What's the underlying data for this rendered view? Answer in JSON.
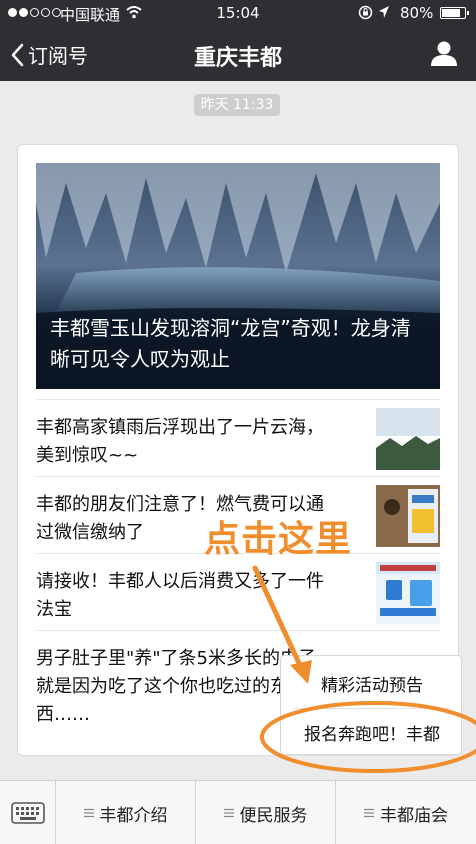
{
  "status_bar": {
    "carrier": "中国联通",
    "time": "15:04",
    "battery_percent": "80%",
    "battery_level": 0.8
  },
  "nav": {
    "back_label": "订阅号",
    "title": "重庆丰都"
  },
  "chat": {
    "timestamp": "昨天 11:33"
  },
  "article": {
    "hero_title": "丰都雪玉山发现溶洞“龙宫”奇观！龙身清晰可见令人叹为观止",
    "items": [
      {
        "title": "丰都高家镇雨后浮现出了一片云海，美到惊叹~~"
      },
      {
        "title": "丰都的朋友们注意了！燃气费可以通过微信缴纳了"
      },
      {
        "title": "请接收！丰都人以后消费又多了一件法宝"
      },
      {
        "title": "男子肚子里\"养\"了条5米多长的虫子，就是因为吃了这个你也吃过的东西……"
      }
    ]
  },
  "popup_menu": {
    "items": [
      "精彩活动预告",
      "报名奔跑吧！丰都"
    ]
  },
  "annotation": {
    "text": "点击这里",
    "color": "#f08d2c"
  },
  "bottom_menu": {
    "items": [
      "丰都介绍",
      "便民服务",
      "丰都庙会"
    ]
  },
  "colors": {
    "header_bg": "#2e2e33",
    "chat_bg": "#ebebeb"
  }
}
